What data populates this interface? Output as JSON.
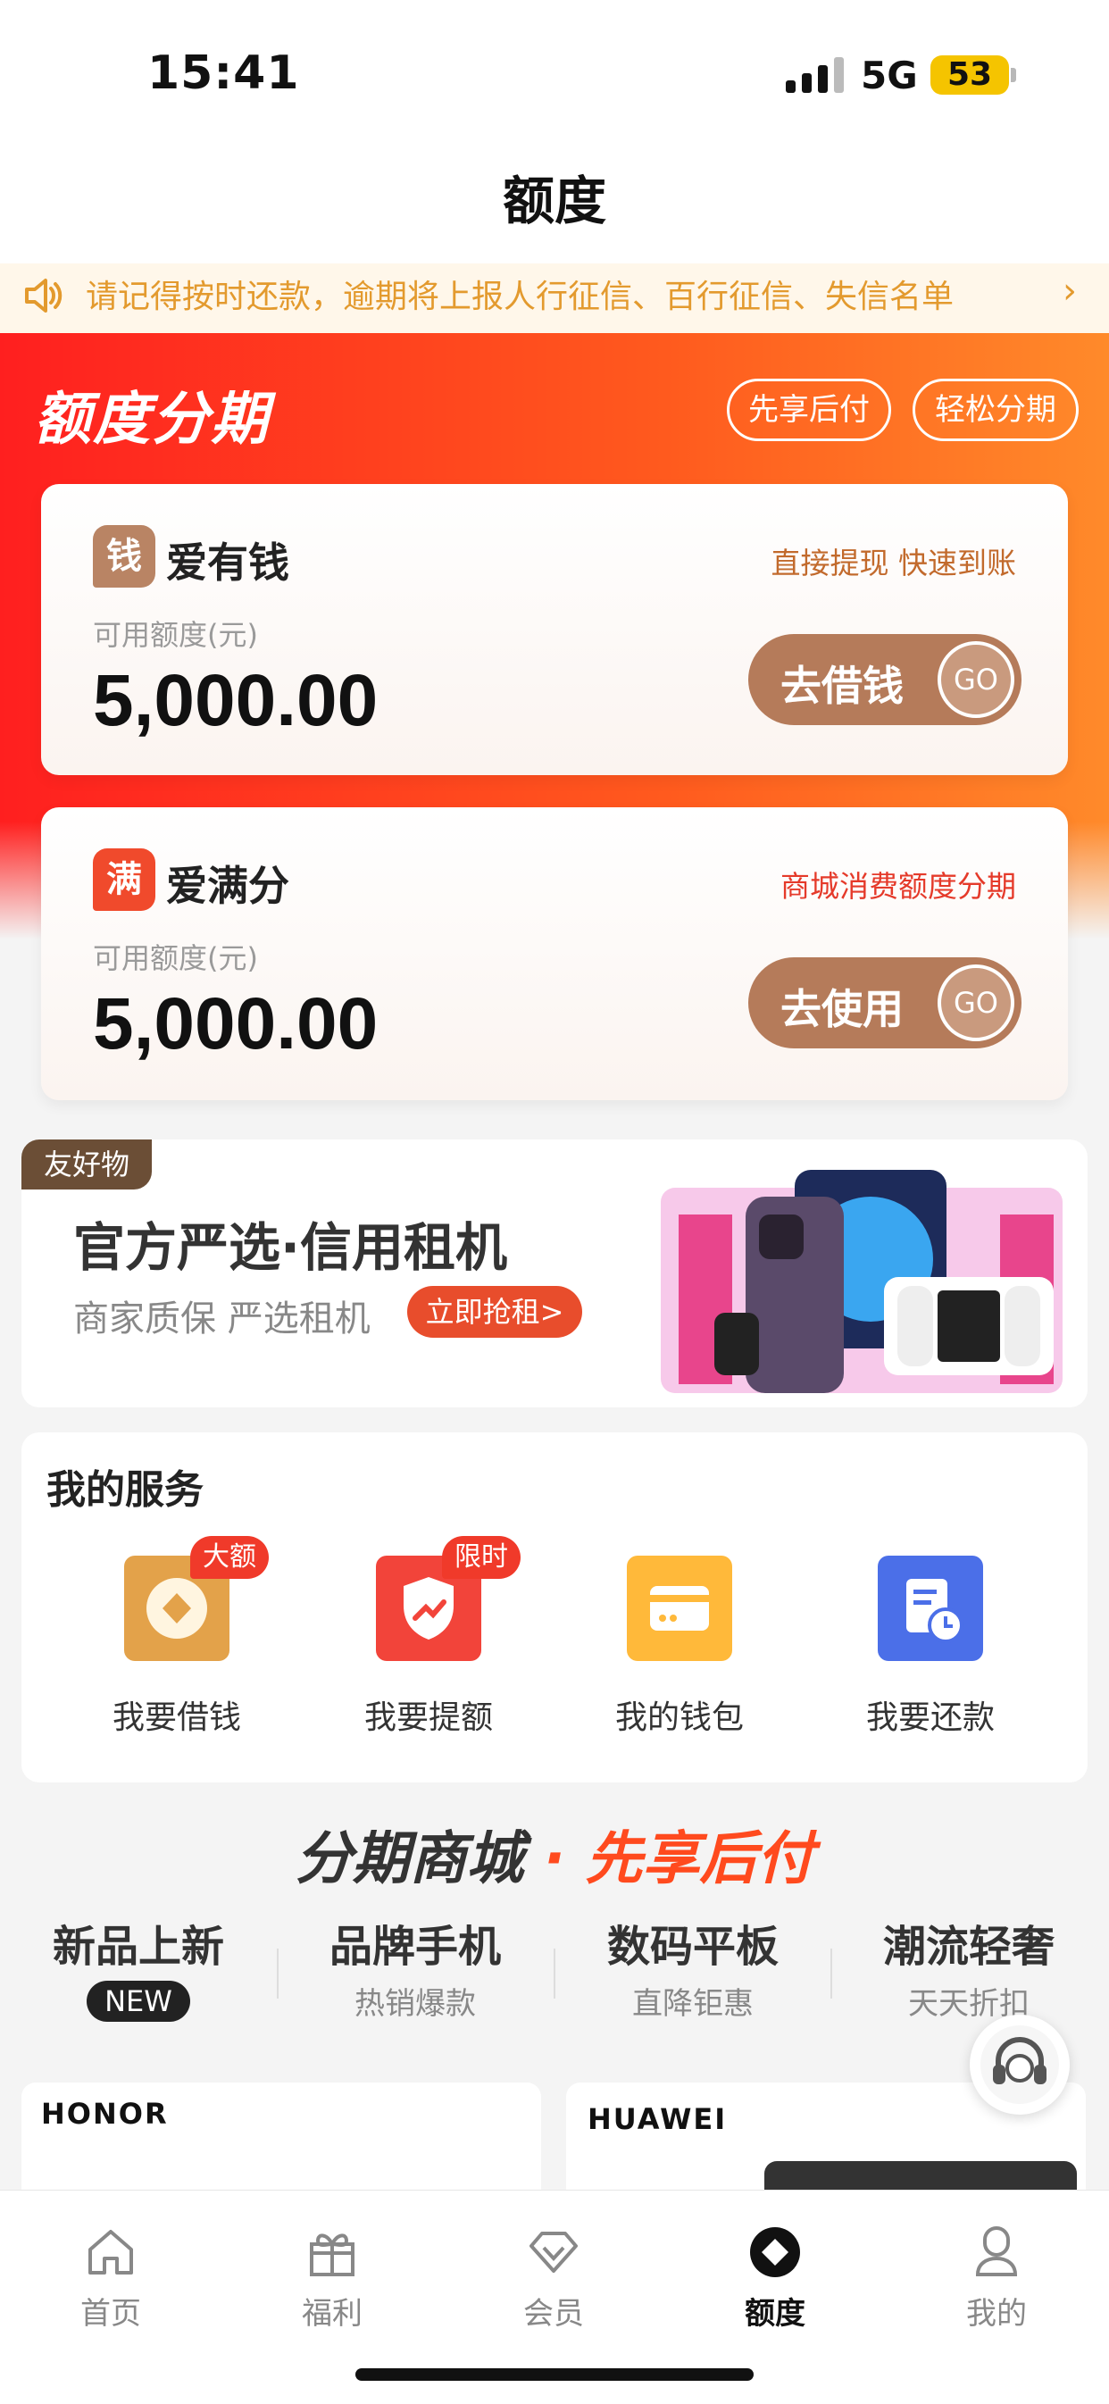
{
  "status_bar": {
    "time": "15:41",
    "network": "5G",
    "battery": "53"
  },
  "header": {
    "title": "额度"
  },
  "notice": {
    "text": "请记得按时还款，逾期将上报人行征信、百行征信、失信名单"
  },
  "hero": {
    "title": "额度分期",
    "pill_left": "先享后付",
    "pill_right": "轻松分期"
  },
  "cards": [
    {
      "badge": "钱",
      "name": "爱有钱",
      "tag": "直接提现 快速到账",
      "avail_label": "可用额度(元)",
      "amount": "5,000.00",
      "button": "去借钱",
      "go": "GO"
    },
    {
      "badge": "满",
      "name": "爱满分",
      "tag": "商城消费额度分期",
      "avail_label": "可用额度(元)",
      "amount": "5,000.00",
      "button": "去使用",
      "go": "GO"
    }
  ],
  "rental": {
    "tag": "友好物",
    "title": "官方严选·信用租机",
    "subtitle": "商家质保 严选租机",
    "button": "立即抢租>"
  },
  "services": {
    "title": "我的服务",
    "items": [
      {
        "label": "我要借钱",
        "badge": "大额",
        "icon": "coin-icon",
        "color": "#e3a24a"
      },
      {
        "label": "我要提额",
        "badge": "限时",
        "icon": "shield-up-icon",
        "color": "#f2443a"
      },
      {
        "label": "我的钱包",
        "badge": "",
        "icon": "wallet-icon",
        "color": "#ffb93a"
      },
      {
        "label": "我要还款",
        "badge": "",
        "icon": "bill-clock-icon",
        "color": "#4b6fe8"
      }
    ]
  },
  "mall": {
    "title_a": "分期商城",
    "title_b": "· 先享后付",
    "categories": [
      {
        "name": "新品上新",
        "sub": "NEW"
      },
      {
        "name": "品牌手机",
        "sub": "热销爆款"
      },
      {
        "name": "数码平板",
        "sub": "直降钜惠"
      },
      {
        "name": "潮流轻奢",
        "sub": "天天折扣"
      }
    ],
    "products": [
      {
        "brand": "HONOR"
      },
      {
        "brand": "HUAWEI"
      }
    ]
  },
  "tabbar": [
    {
      "label": "首页",
      "icon": "home-icon",
      "active": false
    },
    {
      "label": "福利",
      "icon": "gift-icon",
      "active": false
    },
    {
      "label": "会员",
      "icon": "diamond-icon",
      "active": false
    },
    {
      "label": "额度",
      "icon": "quota-icon",
      "active": true
    },
    {
      "label": "我的",
      "icon": "profile-icon",
      "active": false
    }
  ],
  "colors": {
    "accent": "#ff3a1f",
    "brown": "#b57b5a",
    "notice": "#e39a2e"
  }
}
